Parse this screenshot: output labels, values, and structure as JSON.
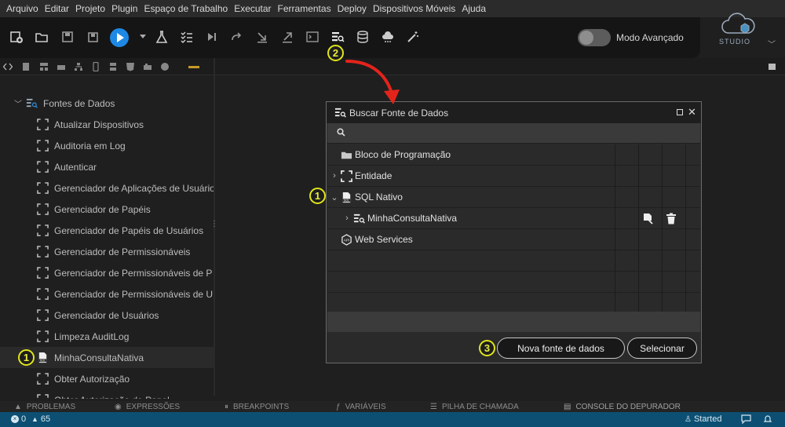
{
  "menu": [
    "Arquivo",
    "Editar",
    "Projeto",
    "Plugin",
    "Espaço de Trabalho",
    "Executar",
    "Ferramentas",
    "Deploy",
    "Dispositivos Móveis",
    "Ajuda"
  ],
  "toolbar": {
    "advanced_mode_label": "Modo Avançado"
  },
  "studio": {
    "label": "STUDIO"
  },
  "tree": {
    "root": "Fontes de Dados",
    "items": [
      "Atualizar Dispositivos",
      "Auditoria em Log",
      "Autenticar",
      "Gerenciador de Aplicações de Usuário",
      "Gerenciador de Papéis",
      "Gerenciador de Papéis de Usuários",
      "Gerenciador de Permissionáveis",
      "Gerenciador de Permissionáveis de P",
      "Gerenciador de Permissionáveis de U",
      "Gerenciador de Usuários",
      "Limpeza AuditLog",
      "MinhaConsultaNativa",
      "Obter Autorização",
      "Obter Autorização de Papel"
    ]
  },
  "dialog": {
    "title": "Buscar Fonte de Dados",
    "search_placeholder": "",
    "rows": [
      {
        "label": "Bloco de Programação",
        "icon": "folder-icon"
      },
      {
        "label": "Entidade",
        "icon": "entity-icon"
      },
      {
        "label": "SQL Nativo",
        "icon": "sql-icon"
      },
      {
        "label": "MinhaConsultaNativa",
        "icon": "datasource-icon"
      },
      {
        "label": "Web Services",
        "icon": "api-icon"
      }
    ],
    "new_button": "Nova fonte de dados",
    "select_button": "Selecionar"
  },
  "annotations": {
    "one": "1",
    "two": "2",
    "three": "3"
  },
  "bottom_tabs": [
    "PROBLEMAS",
    "EXPRESSÕES",
    "BREAKPOINTS",
    "VARIÁVEIS",
    "PILHA DE CHAMADA",
    "CONSOLE DO DEPURADOR"
  ],
  "status": {
    "errors": "0",
    "warnings": "65",
    "state": "Started"
  },
  "colors": {
    "accent": "#1e88e5",
    "status_bar": "#0c4f73",
    "badge": "#e0e51a",
    "arrow": "#e3241b"
  }
}
